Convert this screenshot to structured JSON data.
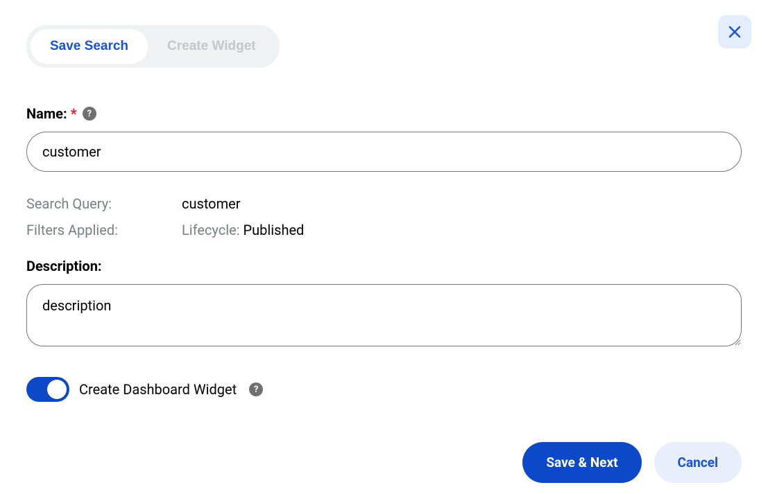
{
  "tabs": [
    {
      "label": "Save Search",
      "active": true
    },
    {
      "label": "Create Widget",
      "active": false
    }
  ],
  "close_icon": "close",
  "form": {
    "name_label": "Name:",
    "name_required": "*",
    "name_value": "customer",
    "search_query_label": "Search Query:",
    "search_query_value": "customer",
    "filters_applied_label": "Filters Applied:",
    "filters_applied_prefix": "Lifecycle: ",
    "filters_applied_value": "Published",
    "description_label": "Description:",
    "description_value": "description",
    "toggle_on": true,
    "toggle_label": "Create Dashboard Widget"
  },
  "buttons": {
    "primary": "Save & Next",
    "secondary": "Cancel"
  },
  "help_icon_glyph": "?"
}
